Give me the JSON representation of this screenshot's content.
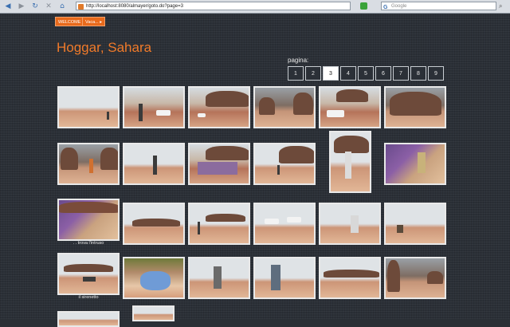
{
  "browser": {
    "url": "http://localhost:8080/almayer/goto.do?page=3",
    "search_placeholder": "Google"
  },
  "breadcrumb": [
    "WELCOME",
    "Vaca...  ▸"
  ],
  "page_title": "Hoggar, Sahara",
  "pagination": {
    "label": "pagina:",
    "pages": [
      "1",
      "2",
      "3",
      "4",
      "5",
      "6",
      "7",
      "8",
      "9"
    ],
    "current": "3"
  },
  "captions": {
    "trova": ". . trova l'intruso",
    "sirenetto": "il sirenetto"
  }
}
